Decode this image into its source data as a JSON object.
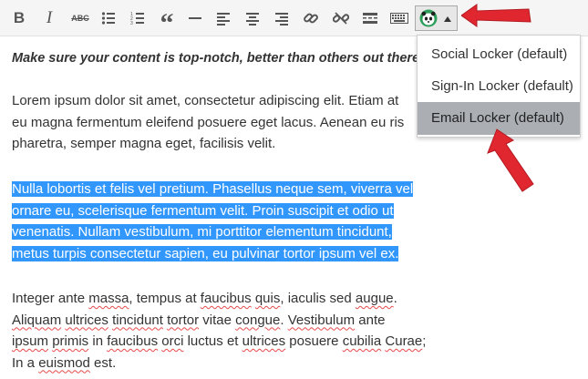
{
  "toolbar": {
    "buttons": [
      {
        "name": "bold-button",
        "icon": "bold-icon",
        "glyph": "B"
      },
      {
        "name": "italic-button",
        "icon": "italic-icon",
        "glyph": "I"
      },
      {
        "name": "strikethrough-button",
        "icon": "strikethrough-icon",
        "glyph": "ABC"
      },
      {
        "name": "bulleted-list-button",
        "icon": "bulleted-list-icon"
      },
      {
        "name": "numbered-list-button",
        "icon": "numbered-list-icon"
      },
      {
        "name": "blockquote-button",
        "icon": "blockquote-icon",
        "glyph": "“"
      },
      {
        "name": "horizontal-line-button",
        "icon": "horizontal-line-icon"
      },
      {
        "name": "align-left-button",
        "icon": "align-left-icon"
      },
      {
        "name": "align-center-button",
        "icon": "align-center-icon"
      },
      {
        "name": "align-right-button",
        "icon": "align-right-icon"
      },
      {
        "name": "insert-link-button",
        "icon": "link-icon"
      },
      {
        "name": "remove-link-button",
        "icon": "unlink-icon"
      },
      {
        "name": "read-more-button",
        "icon": "read-more-icon"
      },
      {
        "name": "toolbar-toggle-button",
        "icon": "keyboard-icon"
      }
    ],
    "locker_button": {
      "icon": "panda-icon",
      "caret": "caret-up-icon"
    }
  },
  "content": {
    "intro": "Make sure your content is top-notch, better than others out there.",
    "paragraph1": [
      "Lorem ipsum dolor sit amet, consectetur adipiscing elit. Etiam at",
      "eu magna fermentum eleifend posuere eget lacus. Aenean eu ris",
      "pharetra, semper magna eget, facilisis velit."
    ],
    "paragraph2_selected": [
      "Nulla lobortis et felis vel pretium. Phasellus neque sem, viverra vel",
      "ornare eu, scelerisque fermentum velit. Proin suscipit et odio ut",
      "venenatis. Nullam vestibulum, mi porttitor elementum tincidunt,",
      "metus turpis consectetur sapien, eu pulvinar tortor ipsum vel ex."
    ],
    "paragraph3": [
      "Integer ante massa, tempus at faucibus quis, iaculis sed augue.",
      "Aliquam ultrices tincidunt tortor vitae congue. Vestibulum ante",
      "ipsum primis in faucibus orci luctus et ultrices posuere cubilia Curae;",
      "In a euismod est."
    ]
  },
  "dropdown": {
    "items": [
      {
        "label": "Social Locker (default)",
        "active": false
      },
      {
        "label": "Sign-In Locker (default)",
        "active": false
      },
      {
        "label": "Email Locker (default)",
        "active": true
      }
    ]
  },
  "colors": {
    "selection": "#3297fd",
    "active_item": "#abafb4",
    "annotation_arrow": "#e0262f",
    "spellcheck": "#e84a4a"
  }
}
